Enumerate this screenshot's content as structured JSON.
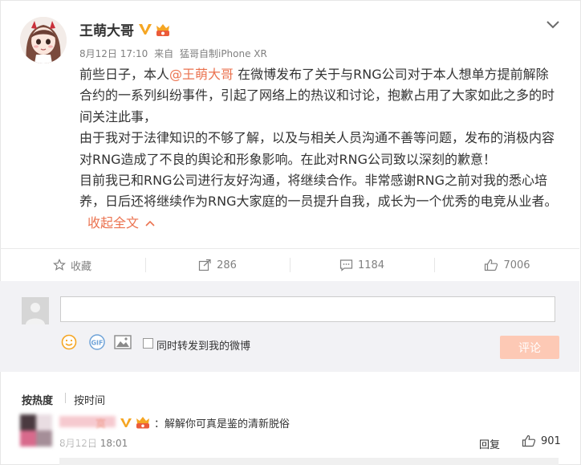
{
  "colors": {
    "accent": "#eb7350",
    "verified_badge": "#f5a623",
    "button_disabled": "#fdc9b5",
    "muted_text": "#808080",
    "comment_box_bg": "#f2f2f5"
  },
  "post": {
    "author": "王萌大哥",
    "date": "8月12日 17:10",
    "source_prefix": "来自",
    "source": "猛哥自制iPhone XR",
    "paragraphs": {
      "p1_before": "前些日子，本人",
      "p1_mention": "@王萌大哥",
      "p1_after": " 在微博发布了关于与RNG公司对于本人想单方提前解除合约的一系列纠纷事件，引起了网络上的热议和讨论，抱歉占用了大家如此之多的时间关注此事，",
      "p2": "由于我对于法律知识的不够了解，以及与相关人员沟通不善等问题，发布的消极内容对RNG造成了不良的舆论和形象影响。在此对RNG公司致以深刻的歉意！",
      "p3": "目前我已和RNG公司进行友好沟通，将继续合作。非常感谢RNG之前对我的悉心培养，日后还将继续作为RNG大家庭的一员提升自我，成长为一个优秀的电竞从业者。"
    },
    "collapse_label": "收起全文"
  },
  "actions": {
    "favorite_label": "收藏",
    "repost_count": "286",
    "comment_count": "1184",
    "like_count": "7006"
  },
  "comment_box": {
    "input_value": "",
    "repost_checkbox_label": "同时转发到我的微博",
    "submit_label": "评论",
    "icons": [
      "smiley-icon",
      "gif-icon",
      "image-icon"
    ]
  },
  "sort": {
    "hot_label": "按热度",
    "time_label": "按时间"
  },
  "comment": {
    "name_tail": "寞",
    "text": "：解解你可真是鉴的清新脱俗",
    "time_visible": "8月12日 18:01",
    "reply_label": "回复",
    "like_count": "901"
  }
}
